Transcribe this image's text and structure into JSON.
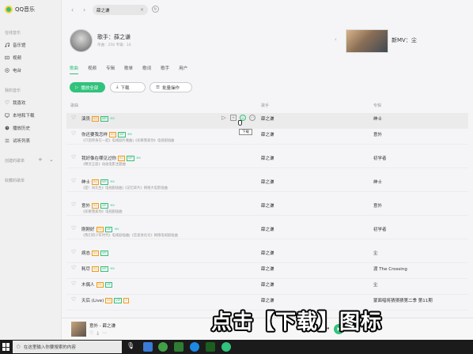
{
  "app": {
    "logo_text": "QQ音乐"
  },
  "sidebar": {
    "online_section": "在线音乐",
    "online_items": [
      {
        "label": "音乐馆",
        "icon": "music-hall-icon"
      },
      {
        "label": "视频",
        "icon": "video-icon"
      },
      {
        "label": "电台",
        "icon": "radio-icon"
      }
    ],
    "my_section": "我的音乐",
    "my_items": [
      {
        "label": "我喜欢",
        "icon": "heart-icon"
      },
      {
        "label": "本地和下载",
        "icon": "computer-icon"
      },
      {
        "label": "播放历史",
        "icon": "clock-icon"
      },
      {
        "label": "试听列表",
        "icon": "list-icon"
      }
    ],
    "created_section": "创建的歌单",
    "collected_section": "收藏的歌单"
  },
  "topbar": {
    "search_value": "薛之谦",
    "clear_icon": "close-icon"
  },
  "singer": {
    "name_line": "歌手：薛之谦",
    "meta_line": "单曲：256  专辑：16"
  },
  "mv": {
    "label": "新MV：尘"
  },
  "tabs": [
    "歌曲",
    "视频",
    "专辑",
    "歌单",
    "歌词",
    "歌手",
    "用户"
  ],
  "actions": {
    "play_all": "播放全部",
    "download": "下载",
    "batch": "批量操作"
  },
  "columns": {
    "song": "歌曲",
    "artist": "歌手",
    "album": "专辑"
  },
  "badges": {
    "sq": "SQ",
    "vip": "VIP",
    "mv": "MV",
    "plus": "+"
  },
  "songs": [
    {
      "title": "演员",
      "sub": "",
      "artist": "薛之谦",
      "album": "绅士"
    },
    {
      "title": "你还要我怎样",
      "sub": "《只因单身在一起》电视剧片尾曲|《如果我爱你》电视剧插曲",
      "artist": "薛之谦",
      "album": "意外"
    },
    {
      "title": "我好像在哪见过你",
      "sub": "《精灵王座》动画电影主题曲",
      "artist": "薛之谦",
      "album": "初学者"
    },
    {
      "title": "绅士",
      "sub": "《是！尚先生》电视剧插曲|《记忆碎片》网络大电影插曲",
      "artist": "薛之谦",
      "album": "绅士"
    },
    {
      "title": "意外",
      "sub": "《如果我爱你》电视剧插曲",
      "artist": "薛之谦",
      "album": "意外"
    },
    {
      "title": "刚刚好",
      "sub": "《我们的少年时代》电视剧插曲|《恋爱进化论》网络电视剧插曲",
      "artist": "薛之谦",
      "album": "初学者"
    },
    {
      "title": "病态",
      "sub": "",
      "artist": "薛之谦",
      "album": "尘"
    },
    {
      "title": "耗尽",
      "sub": "",
      "artist": "薛之谦",
      "album": "渡 The Crossing"
    },
    {
      "title": "木偶人",
      "sub": "",
      "artist": "薛之谦",
      "album": "尘"
    },
    {
      "title": "天后 (Live)",
      "sub": "",
      "artist": "薛之谦",
      "album": "蒙面唱将猜猜猜第二季 第11期"
    }
  ],
  "tooltip": "下载",
  "player": {
    "title": "意外 - 薛之谦"
  },
  "caption": "点击【下载】图标",
  "taskbar": {
    "search_placeholder": "在这里输入你要搜索的内容"
  },
  "colors": {
    "accent": "#31c27c",
    "badge": "#f39c12"
  }
}
